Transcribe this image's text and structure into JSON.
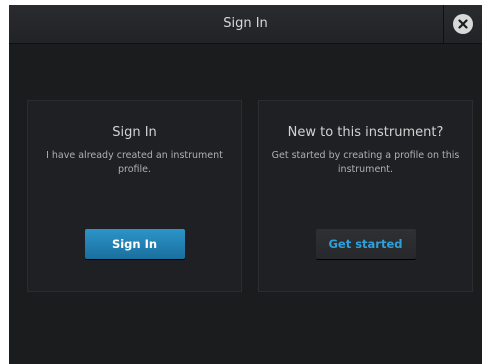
{
  "header": {
    "title": "Sign In"
  },
  "signin_panel": {
    "title": "Sign In",
    "description": "I have already created an instrument profile.",
    "button_label": "Sign In"
  },
  "new_panel": {
    "title": "New to this instrument?",
    "description": "Get started by creating a profile on this instrument.",
    "button_label": "Get started"
  },
  "colors": {
    "accent": "#2c94c9",
    "link_text": "#2fa0d8",
    "background": "#1b1c1e"
  },
  "icons": {
    "close": "close-icon"
  }
}
